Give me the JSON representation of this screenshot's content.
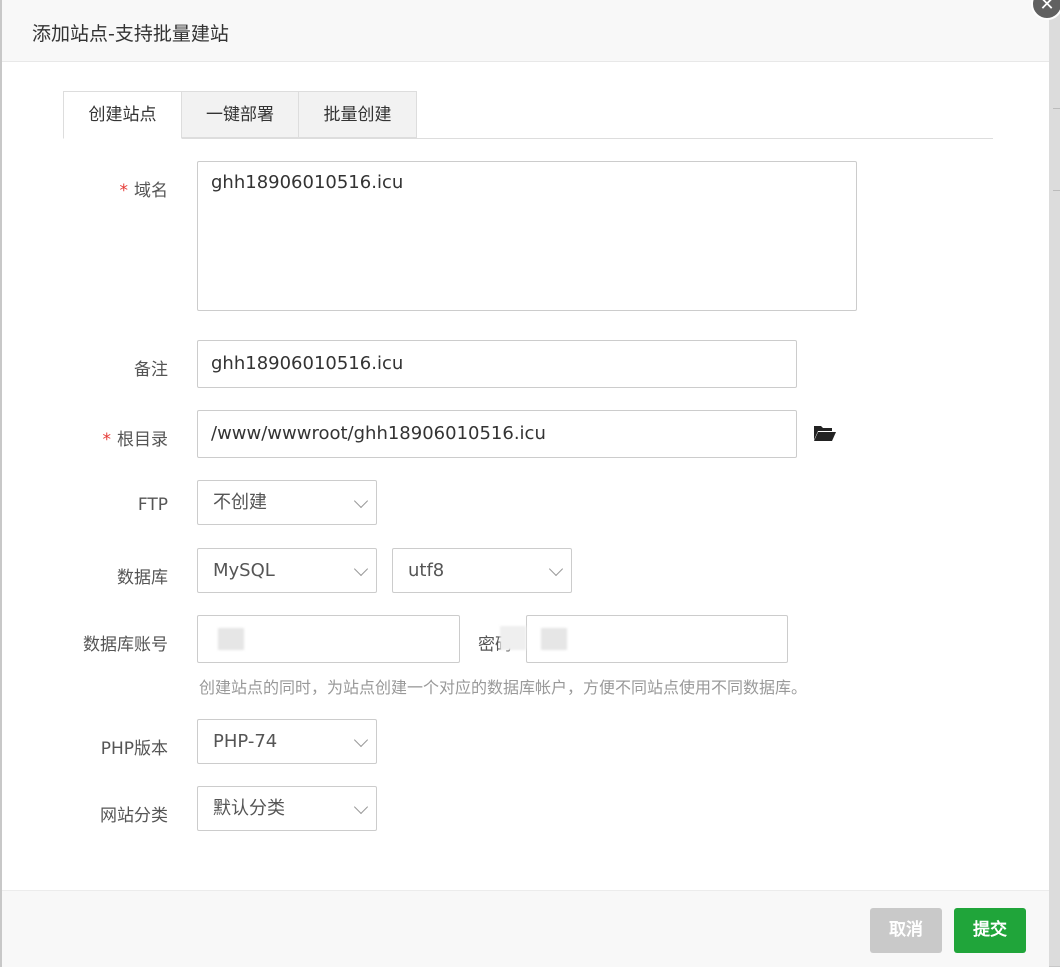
{
  "dialog": {
    "title": "添加站点-支持批量建站",
    "close_glyph": "✕"
  },
  "tabs": [
    {
      "label": "创建站点",
      "active": true
    },
    {
      "label": "一键部署",
      "active": false
    },
    {
      "label": "批量创建",
      "active": false
    }
  ],
  "form": {
    "domain": {
      "label": "域名",
      "required": "*",
      "value": "ghh18906010516.icu"
    },
    "note": {
      "label": "备注",
      "value": "ghh18906010516.icu"
    },
    "root": {
      "label": "根目录",
      "required": "*",
      "value": "/www/wwwroot/ghh18906010516.icu",
      "icon": "folder-open-icon"
    },
    "ftp": {
      "label": "FTP",
      "selected": "不创建"
    },
    "database": {
      "label": "数据库",
      "type_selected": "MySQL",
      "charset_selected": "utf8"
    },
    "db_account": {
      "label": "数据库账号",
      "password_label": "密码",
      "hint": "创建站点的同时，为站点创建一个对应的数据库帐户，方便不同站点使用不同数据库。"
    },
    "php": {
      "label": "PHP版本",
      "selected": "PHP-74"
    },
    "category": {
      "label": "网站分类",
      "selected": "默认分类"
    }
  },
  "footer": {
    "cancel_label": "取消",
    "submit_label": "提交"
  },
  "colors": {
    "primary": "#20a53a",
    "required": "#e53935",
    "cancel": "#c9c9c9"
  }
}
